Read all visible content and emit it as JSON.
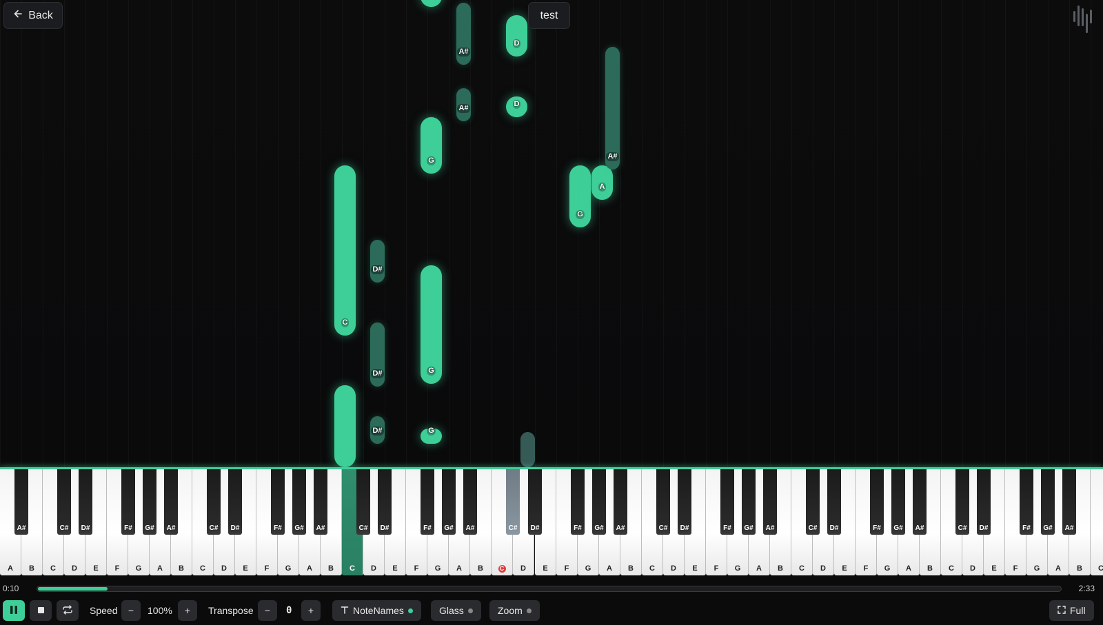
{
  "header": {
    "back_label": "Back",
    "song_title": "test",
    "logo_icon": "equalizer-logo-icon"
  },
  "colors": {
    "accent": "#3ecf98",
    "background": "#0b0b0c",
    "recording_dot": "#e23b3b"
  },
  "roll_notes": [
    {
      "label": "C",
      "style": "bright"
    },
    {
      "label": "",
      "style": "bright"
    },
    {
      "label": "D#",
      "style": "dim"
    },
    {
      "label": "D#",
      "style": "dim"
    },
    {
      "label": "D#",
      "style": "dim"
    },
    {
      "label": "G",
      "style": "bright"
    },
    {
      "label": "G",
      "style": "bright"
    },
    {
      "label": "G",
      "style": "bright"
    },
    {
      "label": "G",
      "style": "bright"
    },
    {
      "label": "A#",
      "style": "dim"
    },
    {
      "label": "A#",
      "style": "dim"
    },
    {
      "label": "D",
      "style": "bright"
    },
    {
      "label": "D",
      "style": "bright"
    },
    {
      "label": "",
      "style": "gray"
    },
    {
      "label": "G",
      "style": "bright"
    },
    {
      "label": "A",
      "style": "bright"
    },
    {
      "label": "A#",
      "style": "dim"
    }
  ],
  "keyboard": {
    "white_keys": [
      "A",
      "B",
      "C",
      "D",
      "E",
      "F",
      "G",
      "A",
      "B",
      "C",
      "D",
      "E",
      "F",
      "G",
      "A",
      "B",
      "C",
      "D",
      "E",
      "F",
      "G",
      "A",
      "B",
      "C",
      "D",
      "E",
      "F",
      "G",
      "A",
      "B",
      "C",
      "D",
      "E",
      "F",
      "G",
      "A",
      "B",
      "C",
      "D",
      "E",
      "F",
      "G",
      "A",
      "B",
      "C",
      "D",
      "E",
      "F",
      "G",
      "A",
      "B",
      "C"
    ],
    "active_white": [
      "C"
    ],
    "marked_white_label": "C",
    "black_key_names": [
      "A#",
      "C#",
      "D#",
      "F#",
      "G#",
      "A#",
      "C#",
      "D#",
      "F#",
      "G#",
      "A#",
      "C#",
      "D#",
      "F#",
      "G#",
      "A#",
      "C#",
      "D#",
      "F#",
      "G#",
      "A#",
      "C#",
      "D#",
      "F#",
      "G#",
      "A#",
      "C#",
      "D#",
      "F#",
      "G#",
      "A#",
      "C#",
      "D#",
      "F#",
      "G#",
      "A#"
    ],
    "active_black": [
      "D#"
    ]
  },
  "playback": {
    "current_time": "0:10",
    "total_time": "2:33",
    "progress": 0.068
  },
  "controls": {
    "play_pause_icon": "pause-icon",
    "stop_icon": "stop-icon",
    "loop_icon": "loop-icon",
    "speed_label": "Speed",
    "speed_value": "100%",
    "minus": "−",
    "plus": "+",
    "transpose_label": "Transpose",
    "transpose_value": "0",
    "note_names_label": "NoteNames",
    "note_names_on": true,
    "glass_label": "Glass",
    "glass_on": false,
    "zoom_label": "Zoom",
    "zoom_on": false,
    "fullscreen_label": "Full"
  }
}
